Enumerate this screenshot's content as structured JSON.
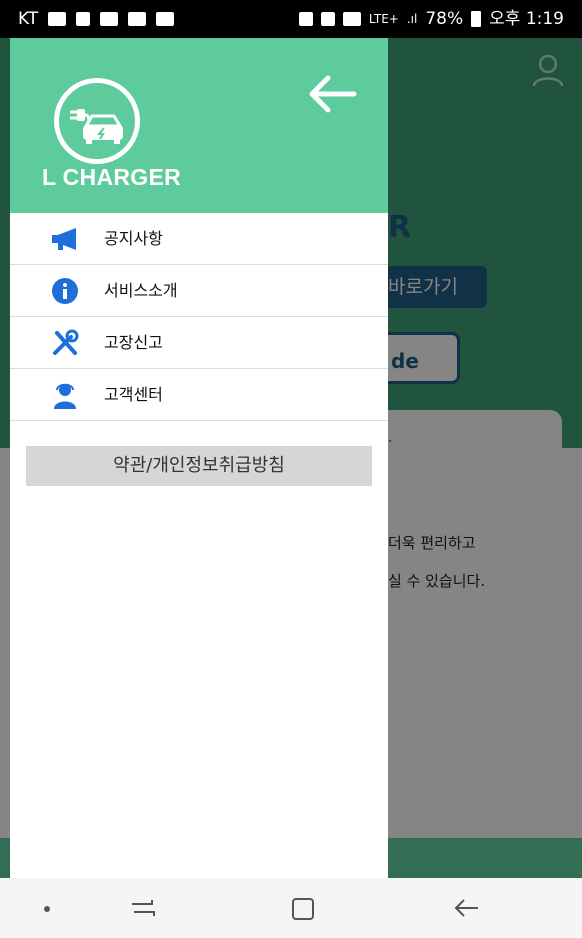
{
  "status_bar": {
    "carrier": "KT",
    "network": "LTE+",
    "battery": "78%",
    "time": "오후 1:19"
  },
  "background_app": {
    "title_fragment": "R",
    "button_label": "바로가기",
    "outline_button_label": "de",
    "card_text": ".",
    "description_line1": "더욱 편리하고",
    "description_line2": "실 수 있습니다."
  },
  "drawer": {
    "brand_name": "L CHARGER",
    "menu_items": [
      {
        "label": "공지사항",
        "icon": "megaphone-icon"
      },
      {
        "label": "서비스소개",
        "icon": "info-icon"
      },
      {
        "label": "고장신고",
        "icon": "tools-icon"
      },
      {
        "label": "고객센터",
        "icon": "support-agent-icon"
      }
    ],
    "policy_button": "약관/개인정보취급방침"
  },
  "colors": {
    "drawer_header": "#5ecb9c",
    "background_header": "#3ea279",
    "accent_blue": "#1e6fd9",
    "policy_button_bg": "#d6d6d6"
  }
}
